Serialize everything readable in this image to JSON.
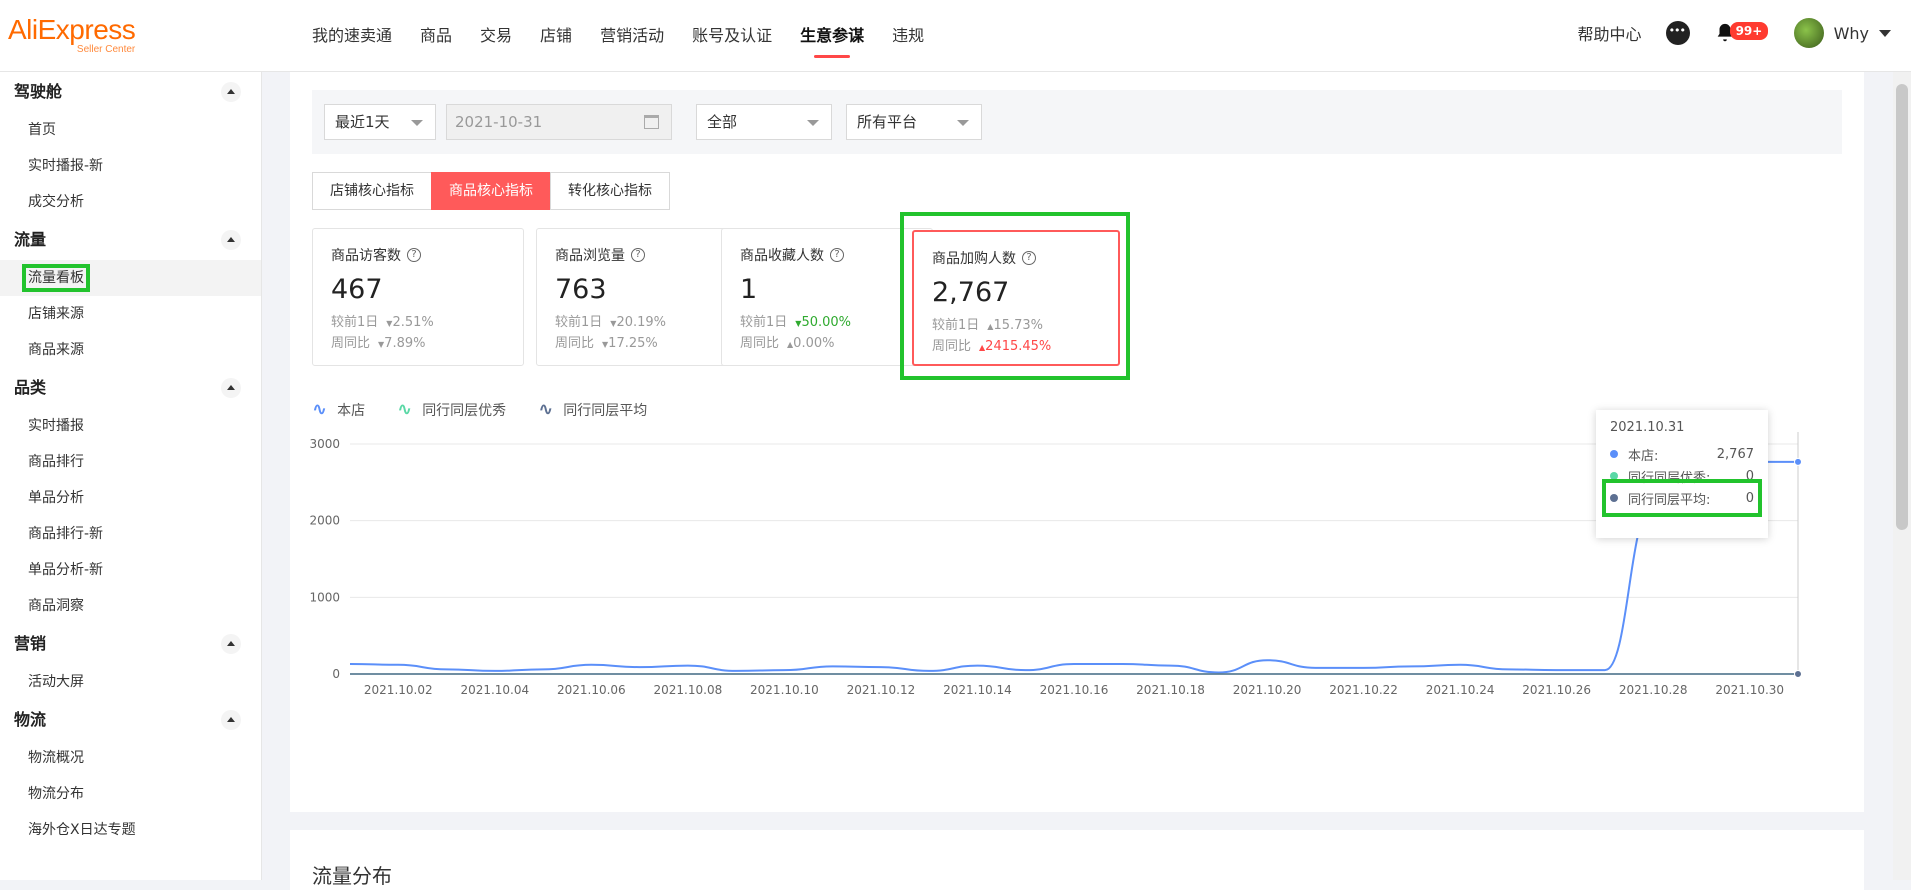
{
  "header": {
    "logo": "AliExpress",
    "logo_sub": "Seller Center",
    "nav": [
      "我的速卖通",
      "商品",
      "交易",
      "店铺",
      "营销活动",
      "账号及认证",
      "生意参谋",
      "违规"
    ],
    "active_nav": "生意参谋",
    "help": "帮助中心",
    "badge": "99+",
    "user": "Why"
  },
  "sidebar": {
    "groups": [
      {
        "label": "驾驶舱",
        "items": [
          "首页",
          "实时播报-新",
          "成交分析"
        ]
      },
      {
        "label": "流量",
        "items": [
          "流量看板",
          "店铺来源",
          "商品来源"
        ]
      },
      {
        "label": "品类",
        "items": [
          "实时播报",
          "商品排行",
          "单品分析",
          "商品排行-新",
          "单品分析-新",
          "商品洞察"
        ]
      },
      {
        "label": "营销",
        "items": [
          "活动大屏"
        ]
      },
      {
        "label": "物流",
        "items": [
          "物流概况",
          "物流分布",
          "海外仓X日达专题"
        ]
      }
    ],
    "active_item": "流量看板"
  },
  "filters": {
    "period": "最近1天",
    "date": "2021-10-31",
    "scope": "全部",
    "platform": "所有平台"
  },
  "tabs": [
    "店铺核心指标",
    "商品核心指标",
    "转化核心指标"
  ],
  "active_tab": "商品核心指标",
  "cards": [
    {
      "title": "商品访客数",
      "value": "467",
      "day_label": "较前1日",
      "day_delta": "2.51%",
      "day_dir": "down",
      "week_label": "周同比",
      "week_delta": "7.89%",
      "week_dir": "down"
    },
    {
      "title": "商品浏览量",
      "value": "763",
      "day_label": "较前1日",
      "day_delta": "20.19%",
      "day_dir": "down",
      "week_label": "周同比",
      "week_delta": "17.25%",
      "week_dir": "down"
    },
    {
      "title": "商品收藏人数",
      "value": "1",
      "day_label": "较前1日",
      "day_delta": "50.00%",
      "day_dir": "down-green",
      "week_label": "周同比",
      "week_delta": "0.00%",
      "week_dir": "up"
    },
    {
      "title": "商品加购人数",
      "value": "2,767",
      "day_label": "较前1日",
      "day_delta": "15.73%",
      "day_dir": "up",
      "week_label": "周同比",
      "week_delta": "2415.45%",
      "week_dir": "up-red"
    }
  ],
  "legend": [
    {
      "label": "本店",
      "color": "#5b8ff9"
    },
    {
      "label": "同行同层优秀",
      "color": "#5ad8a6"
    },
    {
      "label": "同行同层平均",
      "color": "#5d7092"
    }
  ],
  "tooltip": {
    "date": "2021.10.31",
    "rows": [
      {
        "label": "本店:",
        "value": "2,767",
        "color": "#5b8ff9"
      },
      {
        "label": "同行同层优秀:",
        "value": "0",
        "color": "#5ad8a6"
      },
      {
        "label": "同行同层平均:",
        "value": "0",
        "color": "#5d7092"
      }
    ]
  },
  "chart_data": {
    "type": "line",
    "x": [
      "2021.10.01",
      "2021.10.02",
      "2021.10.03",
      "2021.10.04",
      "2021.10.05",
      "2021.10.06",
      "2021.10.07",
      "2021.10.08",
      "2021.10.09",
      "2021.10.10",
      "2021.10.11",
      "2021.10.12",
      "2021.10.13",
      "2021.10.14",
      "2021.10.15",
      "2021.10.16",
      "2021.10.17",
      "2021.10.18",
      "2021.10.19",
      "2021.10.20",
      "2021.10.21",
      "2021.10.22",
      "2021.10.23",
      "2021.10.24",
      "2021.10.25",
      "2021.10.26",
      "2021.10.27",
      "2021.10.28",
      "2021.10.29",
      "2021.10.30",
      "2021.10.31"
    ],
    "x_tick_labels": [
      "2021.10.02",
      "2021.10.04",
      "2021.10.06",
      "2021.10.08",
      "2021.10.10",
      "2021.10.12",
      "2021.10.14",
      "2021.10.16",
      "2021.10.18",
      "2021.10.20",
      "2021.10.22",
      "2021.10.24",
      "2021.10.26",
      "2021.10.28",
      "2021.10.30"
    ],
    "y_ticks": [
      0,
      1000,
      2000,
      3000
    ],
    "ylim": [
      0,
      3000
    ],
    "series": [
      {
        "name": "本店",
        "values": [
          130,
          120,
          60,
          40,
          60,
          120,
          90,
          110,
          40,
          50,
          100,
          90,
          40,
          110,
          50,
          130,
          130,
          110,
          20,
          180,
          80,
          80,
          100,
          120,
          60,
          50,
          50,
          2200,
          2767,
          2767,
          2767
        ]
      },
      {
        "name": "同行同层优秀",
        "values": [
          0,
          0,
          0,
          0,
          0,
          0,
          0,
          0,
          0,
          0,
          0,
          0,
          0,
          0,
          0,
          0,
          0,
          0,
          0,
          0,
          0,
          0,
          0,
          0,
          0,
          0,
          0,
          0,
          0,
          0,
          0
        ]
      },
      {
        "name": "同行同层平均",
        "values": [
          0,
          0,
          0,
          0,
          0,
          0,
          0,
          0,
          0,
          0,
          0,
          0,
          0,
          0,
          0,
          0,
          0,
          0,
          0,
          0,
          0,
          0,
          0,
          0,
          0,
          0,
          0,
          0,
          0,
          0,
          0
        ]
      }
    ]
  },
  "section2_title": "流量分布"
}
